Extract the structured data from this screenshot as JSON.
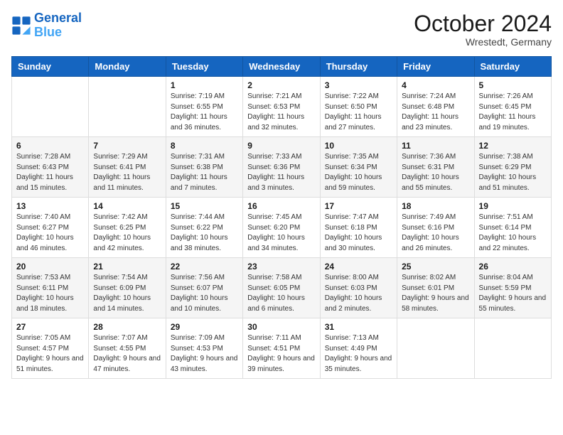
{
  "header": {
    "logo_line1": "General",
    "logo_line2": "Blue",
    "month_title": "October 2024",
    "location": "Wrestedt, Germany"
  },
  "weekdays": [
    "Sunday",
    "Monday",
    "Tuesday",
    "Wednesday",
    "Thursday",
    "Friday",
    "Saturday"
  ],
  "weeks": [
    [
      {
        "day": "",
        "info": ""
      },
      {
        "day": "",
        "info": ""
      },
      {
        "day": "1",
        "info": "Sunrise: 7:19 AM\nSunset: 6:55 PM\nDaylight: 11 hours and 36 minutes."
      },
      {
        "day": "2",
        "info": "Sunrise: 7:21 AM\nSunset: 6:53 PM\nDaylight: 11 hours and 32 minutes."
      },
      {
        "day": "3",
        "info": "Sunrise: 7:22 AM\nSunset: 6:50 PM\nDaylight: 11 hours and 27 minutes."
      },
      {
        "day": "4",
        "info": "Sunrise: 7:24 AM\nSunset: 6:48 PM\nDaylight: 11 hours and 23 minutes."
      },
      {
        "day": "5",
        "info": "Sunrise: 7:26 AM\nSunset: 6:45 PM\nDaylight: 11 hours and 19 minutes."
      }
    ],
    [
      {
        "day": "6",
        "info": "Sunrise: 7:28 AM\nSunset: 6:43 PM\nDaylight: 11 hours and 15 minutes."
      },
      {
        "day": "7",
        "info": "Sunrise: 7:29 AM\nSunset: 6:41 PM\nDaylight: 11 hours and 11 minutes."
      },
      {
        "day": "8",
        "info": "Sunrise: 7:31 AM\nSunset: 6:38 PM\nDaylight: 11 hours and 7 minutes."
      },
      {
        "day": "9",
        "info": "Sunrise: 7:33 AM\nSunset: 6:36 PM\nDaylight: 11 hours and 3 minutes."
      },
      {
        "day": "10",
        "info": "Sunrise: 7:35 AM\nSunset: 6:34 PM\nDaylight: 10 hours and 59 minutes."
      },
      {
        "day": "11",
        "info": "Sunrise: 7:36 AM\nSunset: 6:31 PM\nDaylight: 10 hours and 55 minutes."
      },
      {
        "day": "12",
        "info": "Sunrise: 7:38 AM\nSunset: 6:29 PM\nDaylight: 10 hours and 51 minutes."
      }
    ],
    [
      {
        "day": "13",
        "info": "Sunrise: 7:40 AM\nSunset: 6:27 PM\nDaylight: 10 hours and 46 minutes."
      },
      {
        "day": "14",
        "info": "Sunrise: 7:42 AM\nSunset: 6:25 PM\nDaylight: 10 hours and 42 minutes."
      },
      {
        "day": "15",
        "info": "Sunrise: 7:44 AM\nSunset: 6:22 PM\nDaylight: 10 hours and 38 minutes."
      },
      {
        "day": "16",
        "info": "Sunrise: 7:45 AM\nSunset: 6:20 PM\nDaylight: 10 hours and 34 minutes."
      },
      {
        "day": "17",
        "info": "Sunrise: 7:47 AM\nSunset: 6:18 PM\nDaylight: 10 hours and 30 minutes."
      },
      {
        "day": "18",
        "info": "Sunrise: 7:49 AM\nSunset: 6:16 PM\nDaylight: 10 hours and 26 minutes."
      },
      {
        "day": "19",
        "info": "Sunrise: 7:51 AM\nSunset: 6:14 PM\nDaylight: 10 hours and 22 minutes."
      }
    ],
    [
      {
        "day": "20",
        "info": "Sunrise: 7:53 AM\nSunset: 6:11 PM\nDaylight: 10 hours and 18 minutes."
      },
      {
        "day": "21",
        "info": "Sunrise: 7:54 AM\nSunset: 6:09 PM\nDaylight: 10 hours and 14 minutes."
      },
      {
        "day": "22",
        "info": "Sunrise: 7:56 AM\nSunset: 6:07 PM\nDaylight: 10 hours and 10 minutes."
      },
      {
        "day": "23",
        "info": "Sunrise: 7:58 AM\nSunset: 6:05 PM\nDaylight: 10 hours and 6 minutes."
      },
      {
        "day": "24",
        "info": "Sunrise: 8:00 AM\nSunset: 6:03 PM\nDaylight: 10 hours and 2 minutes."
      },
      {
        "day": "25",
        "info": "Sunrise: 8:02 AM\nSunset: 6:01 PM\nDaylight: 9 hours and 58 minutes."
      },
      {
        "day": "26",
        "info": "Sunrise: 8:04 AM\nSunset: 5:59 PM\nDaylight: 9 hours and 55 minutes."
      }
    ],
    [
      {
        "day": "27",
        "info": "Sunrise: 7:05 AM\nSunset: 4:57 PM\nDaylight: 9 hours and 51 minutes."
      },
      {
        "day": "28",
        "info": "Sunrise: 7:07 AM\nSunset: 4:55 PM\nDaylight: 9 hours and 47 minutes."
      },
      {
        "day": "29",
        "info": "Sunrise: 7:09 AM\nSunset: 4:53 PM\nDaylight: 9 hours and 43 minutes."
      },
      {
        "day": "30",
        "info": "Sunrise: 7:11 AM\nSunset: 4:51 PM\nDaylight: 9 hours and 39 minutes."
      },
      {
        "day": "31",
        "info": "Sunrise: 7:13 AM\nSunset: 4:49 PM\nDaylight: 9 hours and 35 minutes."
      },
      {
        "day": "",
        "info": ""
      },
      {
        "day": "",
        "info": ""
      }
    ]
  ]
}
